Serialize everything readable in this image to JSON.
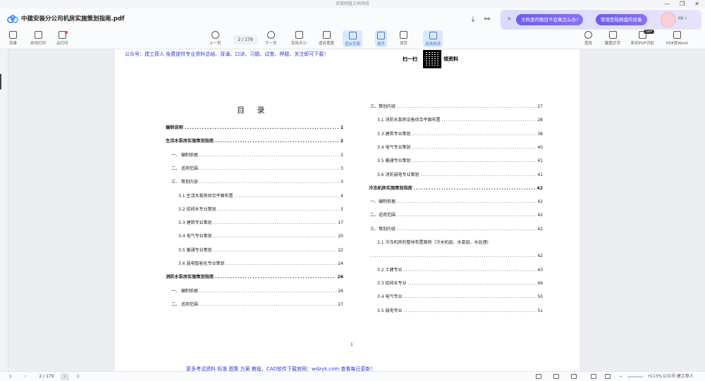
{
  "window": {
    "title": "百度网盘文档预览",
    "minimize": "—",
    "restore": "❐",
    "close": "✕"
  },
  "header": {
    "filename": "中建安装分公司机房实施策划指南.pdf",
    "promo_close": "×",
    "promo_question": "文档里的题目不会做怎么办?",
    "promo_devices": "管理登陆网盘的设备",
    "greeting": "Hi ›"
  },
  "toolbar": {
    "catalog": "目录",
    "local_print": "本地打印",
    "cloud_print": "云打印",
    "prev": "上一页",
    "page_indicator": "2 / 179",
    "next": "下一页",
    "actual_size": "实际大小",
    "fit_width": "适合宽度",
    "fit_page": "适合页面",
    "single_page": "单页",
    "double_page": "双页",
    "continuous": "连续阅读",
    "find": "查找",
    "screenshot_ocr": "截图识字",
    "pdf_ocr": "影印PDF识别",
    "pdf_to_word": "PDF转Word",
    "new_badge": "SVIP"
  },
  "page": {
    "top_banner": "公众号：建工荐人 免费提供专业资料总结、背诵、口诀、习题、试卷、押题，关注即可下载！",
    "qr_left": "扫一扫",
    "qr_right": "领资料",
    "toc_title": "目 录",
    "page_number": "1",
    "bottom_banner": "更多考试资料 标准 图集 方案 教程、CAD软件下载官网：wdzyk.com 查看每日更新！"
  },
  "toc_left": [
    {
      "label": "编制说明",
      "page": "1",
      "bold": true
    },
    {
      "label": "生活水泵房实施策划指南",
      "page": "2",
      "bold": true
    },
    {
      "label": "一、 编制依据",
      "page": "2",
      "bold": false
    },
    {
      "label": "二、 适用范围",
      "page": "3",
      "bold": false
    },
    {
      "label": "三、 策划内容",
      "page": "3",
      "bold": false
    },
    {
      "label": "3.1 生活水泵房综合平面布置",
      "page": "4",
      "bold": false
    },
    {
      "label": "3.2 给排水专业策划",
      "page": "5",
      "bold": false
    },
    {
      "label": "3.3 建筑专业策划",
      "page": "17",
      "bold": false
    },
    {
      "label": "3.4 电气专业策划",
      "page": "20",
      "bold": false
    },
    {
      "label": "3.5 暖通专业策划",
      "page": "22",
      "bold": false
    },
    {
      "label": "3.6 弱电智能化专业策划",
      "page": "24",
      "bold": false
    },
    {
      "label": "消防水泵房实施策划指南",
      "page": "26",
      "bold": true
    },
    {
      "label": "一、 编制依据",
      "page": "26",
      "bold": false
    },
    {
      "label": "二、 适用范围",
      "page": "27",
      "bold": false
    }
  ],
  "toc_right": [
    {
      "label": "三、策划内容",
      "page": "27",
      "bold": false
    },
    {
      "label": "3.1 消防水泵房设备综合平面布置",
      "page": "28",
      "bold": false
    },
    {
      "label": "3.3 建筑专业策划",
      "page": "38",
      "bold": false
    },
    {
      "label": "3.4 电气专业策划",
      "page": "40",
      "bold": false
    },
    {
      "label": "3.5 暖通专业策划",
      "page": "41",
      "bold": false
    },
    {
      "label": "3.6 消防弱电专业策划",
      "page": "41",
      "bold": false
    },
    {
      "label": "冷冻机房实施策划指南",
      "page": "42",
      "bold": true
    },
    {
      "label": "一、编制依据",
      "page": "42",
      "bold": false
    },
    {
      "label": "二、适用范围",
      "page": "42",
      "bold": false
    },
    {
      "label": "三、策划内容",
      "page": "42",
      "bold": false
    },
    {
      "label": "3.1 冷冻机房的整体布置案例（冷水机组、水泵组、水处理)",
      "page": "",
      "bold": false
    },
    {
      "label": "",
      "page": "42",
      "bold": false
    },
    {
      "label": "3.2 土建专业",
      "page": "43",
      "bold": false
    },
    {
      "label": "3.3 给排水专业",
      "page": "49",
      "bold": false
    },
    {
      "label": "3.4 电气专业",
      "page": "50",
      "bold": false
    },
    {
      "label": "3.5 弱电专业",
      "page": "51",
      "bold": false
    }
  ],
  "statusbar": {
    "first": "|‹",
    "prev": "‹",
    "page": "2 / 179",
    "next": "›",
    "last": "›|",
    "zoom_out": "−",
    "zoom_value": "113%",
    "zoom_in": "+",
    "watermark": "公众号·建工荐人"
  }
}
